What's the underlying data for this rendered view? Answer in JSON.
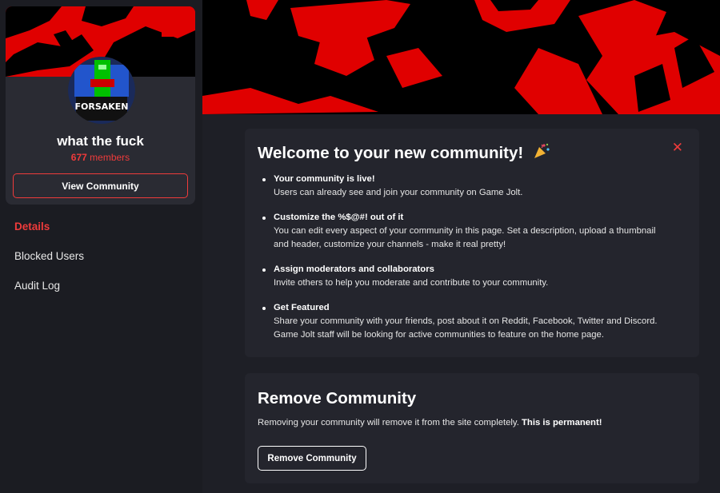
{
  "sidebar": {
    "community": {
      "name": "what the fuck",
      "member_count": "677",
      "member_label": "members",
      "avatar_text": "FORSAKEN",
      "view_button_label": "View Community"
    },
    "nav": [
      {
        "label": "Details",
        "active": true
      },
      {
        "label": "Blocked Users",
        "active": false
      },
      {
        "label": "Audit Log",
        "active": false
      }
    ]
  },
  "welcome": {
    "title": "Welcome to your new community!",
    "title_icon": "party-popper-icon",
    "close_icon": "close-icon",
    "tips": [
      {
        "title": "Your community is live!",
        "desc": "Users can already see and join your community on Game Jolt."
      },
      {
        "title": "Customize the %$@#! out of it",
        "desc": "You can edit every aspect of your community in this page. Set a description, upload a thumbnail and header, customize your channels - make it real pretty!"
      },
      {
        "title": "Assign moderators and collaborators",
        "desc": "Invite others to help you moderate and contribute to your community."
      },
      {
        "title": "Get Featured",
        "desc": "Share your community with your friends, post about it on Reddit, Facebook, Twitter and Discord. Game Jolt staff will be looking for active communities to feature on the home page."
      }
    ]
  },
  "remove": {
    "title": "Remove Community",
    "text": "Removing your community will remove it from the site completely.",
    "warning": "This is permanent!",
    "button_label": "Remove Community"
  },
  "colors": {
    "accent": "#ef3b3b",
    "background": "#1e1f26",
    "card": "#24252d",
    "banner_red": "#e00000"
  }
}
